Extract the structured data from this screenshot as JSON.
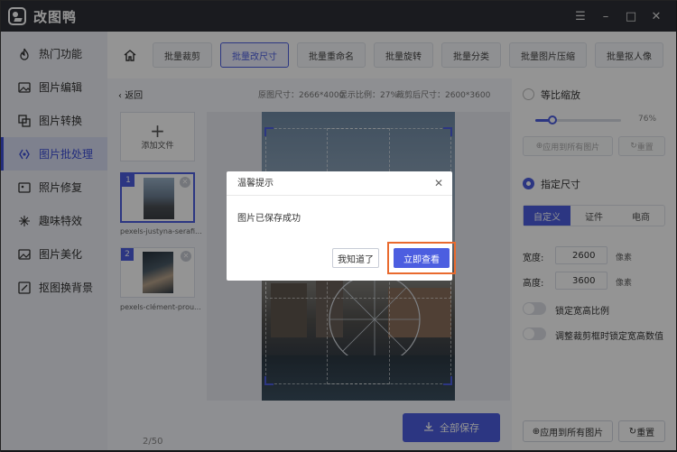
{
  "app": {
    "title": "改图鸭"
  },
  "window_controls": [
    "☰",
    "–",
    "□",
    "✕"
  ],
  "sidebar": {
    "items": [
      {
        "label": "热门功能",
        "icon": "fire-icon"
      },
      {
        "label": "图片编辑",
        "icon": "image-edit-icon"
      },
      {
        "label": "图片转换",
        "icon": "image-convert-icon"
      },
      {
        "label": "图片批处理",
        "icon": "batch-process-icon",
        "active": true
      },
      {
        "label": "照片修复",
        "icon": "photo-repair-icon"
      },
      {
        "label": "趣味特效",
        "icon": "sparkle-icon"
      },
      {
        "label": "图片美化",
        "icon": "beautify-icon"
      },
      {
        "label": "抠图换背景",
        "icon": "cutout-icon"
      }
    ]
  },
  "tabs": [
    {
      "label": "批量裁剪"
    },
    {
      "label": "批量改尺寸",
      "active": true
    },
    {
      "label": "批量重命名"
    },
    {
      "label": "批量旋转"
    },
    {
      "label": "批量分类"
    },
    {
      "label": "批量图片压缩"
    },
    {
      "label": "批量抠人像"
    }
  ],
  "toolbar": {
    "back": "返回",
    "original_size": "原图尺寸：2666*4000",
    "display_ratio": "显示比例：27%",
    "cropped_size": "裁剪后尺寸：2600*3600"
  },
  "files": {
    "add_label": "添加文件",
    "items": [
      {
        "index": "1",
        "name": "pexels-justyna-serafi..."
      },
      {
        "index": "2",
        "name": "pexels-clément-prou..."
      }
    ],
    "pager": "2/50"
  },
  "save_all": "全部保存",
  "right_panel": {
    "proportional_label": "等比缩放",
    "scale_percent": "76%",
    "scale_value": 0.2,
    "apply_all_disabled": "应用到所有图片",
    "reset_disabled": "重置",
    "specify_size_label": "指定尺寸",
    "segments": [
      "自定义",
      "证件",
      "电商"
    ],
    "width_label": "宽度:",
    "width_value": "2600",
    "height_label": "高度:",
    "height_value": "3600",
    "unit": "像素",
    "lock_ratio_label": "锁定宽高比例",
    "lock_crop_label": "调整裁剪框时锁定宽高数值",
    "apply_all": "应用到所有图片",
    "reset": "重置"
  },
  "modal": {
    "title": "温馨提示",
    "message": "图片已保存成功",
    "secondary": "我知道了",
    "primary": "立即查看"
  },
  "colors": {
    "accent": "#4c5ee0",
    "highlight": "#e96a2e",
    "titlebar": "#2e3036"
  }
}
